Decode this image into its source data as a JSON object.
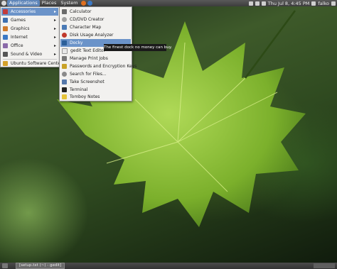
{
  "top_panel": {
    "menus": [
      "Applications",
      "Places",
      "System"
    ],
    "clock": "Thu Jul 8,  4:45 PM",
    "user": "falko"
  },
  "applications_menu": {
    "items": [
      {
        "label": "Accessories",
        "icon": "accessories-icon",
        "color": "#c23b3b"
      },
      {
        "label": "Games",
        "icon": "games-icon",
        "color": "#3d6fb0"
      },
      {
        "label": "Graphics",
        "icon": "graphics-icon",
        "color": "#d07a2a"
      },
      {
        "label": "Internet",
        "icon": "internet-icon",
        "color": "#3a78c4"
      },
      {
        "label": "Office",
        "icon": "office-icon",
        "color": "#8a6aa8"
      },
      {
        "label": "Sound & Video",
        "icon": "sound-video-icon",
        "color": "#555555"
      },
      {
        "label": "Ubuntu Software Center",
        "icon": "software-center-icon",
        "color": "#d4a12a"
      }
    ]
  },
  "accessories_menu": {
    "items": [
      {
        "label": "Calculator",
        "icon": "calculator-icon",
        "color": "#6b6b6b"
      },
      {
        "label": "CD/DVD Creator",
        "icon": "disc-icon",
        "color": "#a0a0a0"
      },
      {
        "label": "Character Map",
        "icon": "character-map-icon",
        "color": "#4a7ab5"
      },
      {
        "label": "Disk Usage Analyzer",
        "icon": "disk-usage-icon",
        "color": "#c0392b"
      },
      {
        "label": "Docky",
        "icon": "docky-icon",
        "color": "#2c5f99"
      },
      {
        "label": "gedit Text Editor",
        "icon": "text-editor-icon",
        "color": "#e8e8e8"
      },
      {
        "label": "Manage Print Jobs",
        "icon": "printer-icon",
        "color": "#777777"
      },
      {
        "label": "Passwords and Encryption Keys",
        "icon": "keys-icon",
        "color": "#c9a227"
      },
      {
        "label": "Search for Files...",
        "icon": "search-icon",
        "color": "#8a8a8a"
      },
      {
        "label": "Take Screenshot",
        "icon": "screenshot-icon",
        "color": "#5577aa"
      },
      {
        "label": "Terminal",
        "icon": "terminal-icon",
        "color": "#222222"
      },
      {
        "label": "Tomboy Notes",
        "icon": "notes-icon",
        "color": "#e6c33a"
      }
    ]
  },
  "tooltip": "The finest dock no money can buy.",
  "bottom_panel": {
    "task": "[setup.txt (~) - gedit]"
  },
  "colors": {
    "highlight": "#6b93c9",
    "panel": "#3c3c3c",
    "menu_bg": "#f2f1ef"
  }
}
